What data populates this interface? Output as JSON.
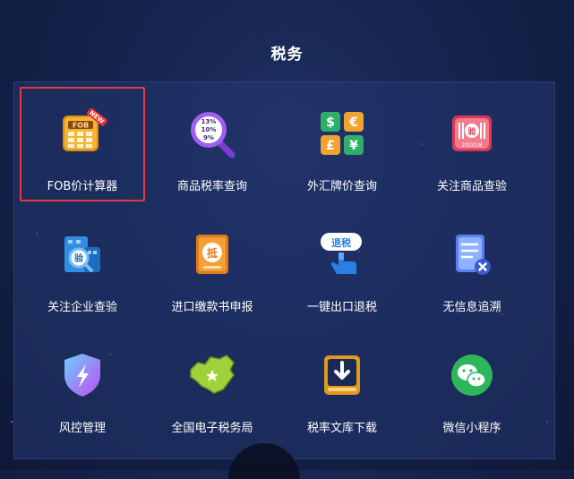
{
  "page": {
    "title": "税务"
  },
  "tiles": [
    {
      "label": "FOB价计算器",
      "icon": "fob-calculator-icon",
      "badge": "NEW",
      "icon_text": "FOB"
    },
    {
      "label": "商品税率查询",
      "icon": "tax-rate-magnifier-icon",
      "icon_lines": [
        "13%",
        "10%",
        "9%"
      ]
    },
    {
      "label": "外汇牌价查询",
      "icon": "currency-exchange-icon",
      "icon_symbols": [
        "$",
        "€",
        "£",
        "¥"
      ]
    },
    {
      "label": "关注商品查验",
      "icon": "goods-inspection-icon",
      "icon_text": "验",
      "icon_subtext": "202018"
    },
    {
      "label": "关注企业查验",
      "icon": "enterprise-inspection-icon",
      "icon_text": "验"
    },
    {
      "label": "进口缴款书申报",
      "icon": "import-payment-icon",
      "icon_text": "抵"
    },
    {
      "label": "一键出口退税",
      "icon": "export-tax-refund-icon",
      "icon_text": "退税"
    },
    {
      "label": "无信息追溯",
      "icon": "trace-document-icon"
    },
    {
      "label": "风控管理",
      "icon": "risk-control-shield-icon"
    },
    {
      "label": "全国电子税务局",
      "icon": "china-map-icon"
    },
    {
      "label": "税率文库下载",
      "icon": "download-library-icon"
    },
    {
      "label": "微信小程序",
      "icon": "wechat-icon"
    }
  ],
  "colors": {
    "active_border": "#e43a3a",
    "background": "#16234d"
  }
}
